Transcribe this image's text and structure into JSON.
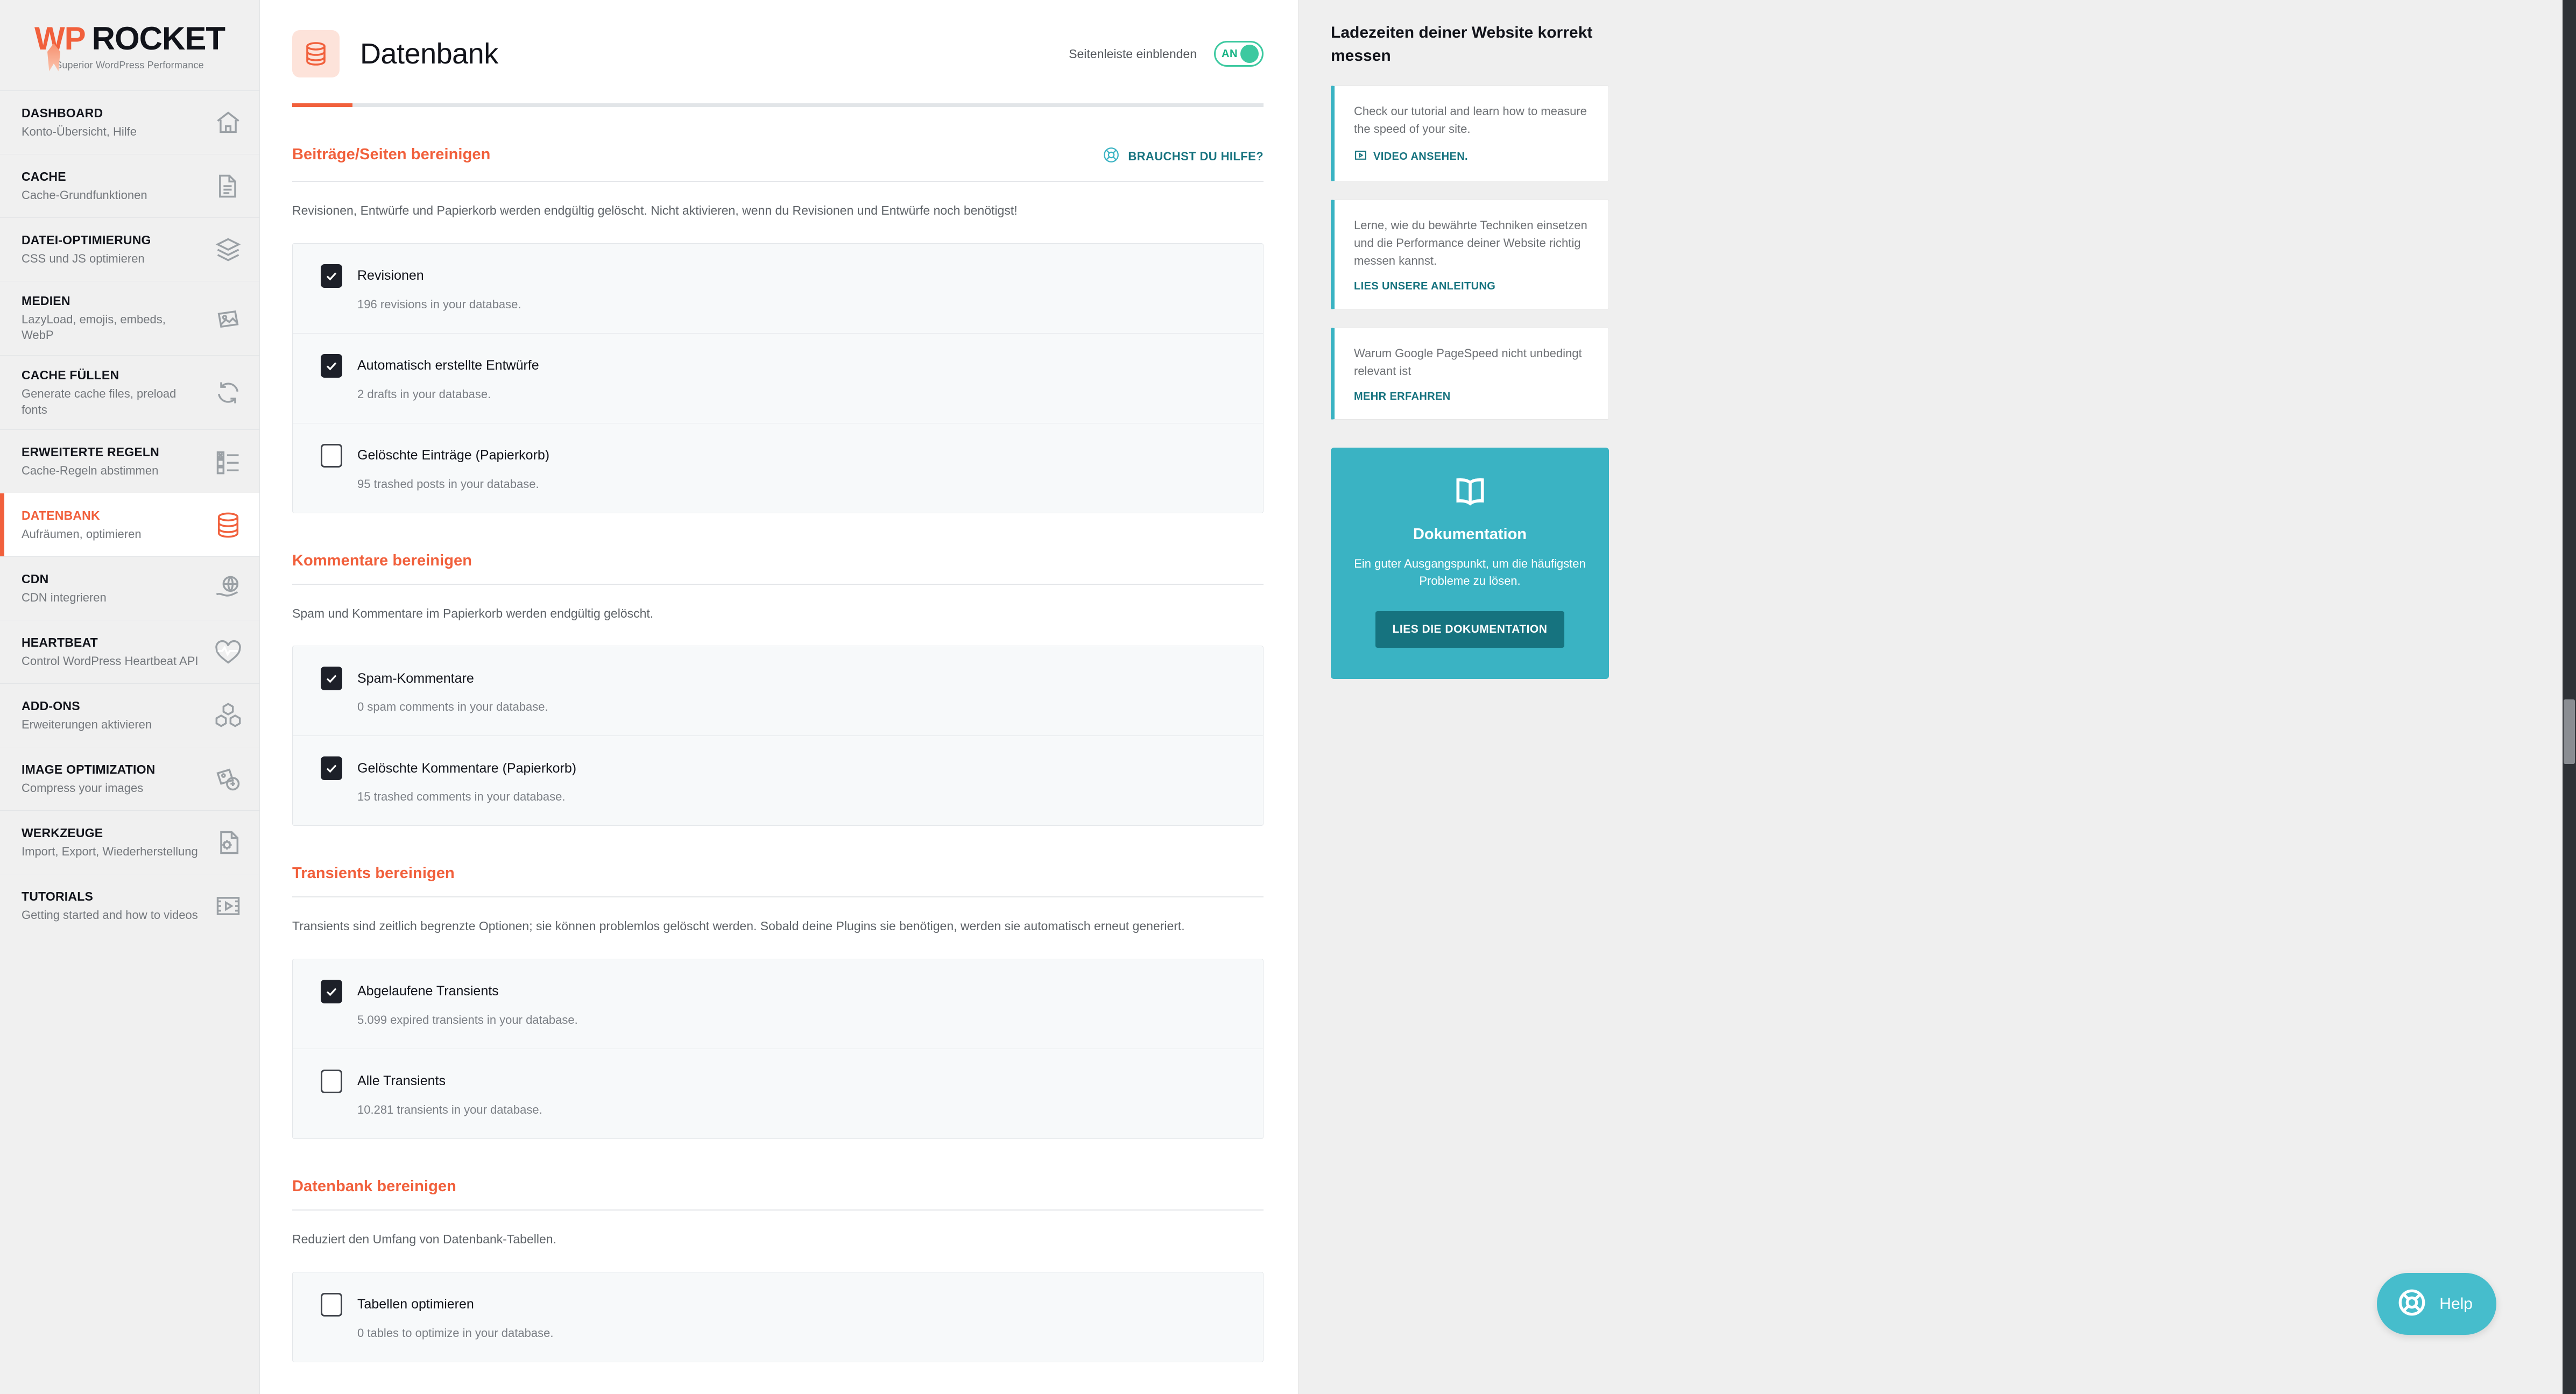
{
  "brand": {
    "name_wp": "WP",
    "name_rocket": "ROCKET",
    "tagline": "Superior WordPress Performance",
    "accent_orange": "#f1603c",
    "accent_teal": "#3ab3c3",
    "accent_teal_dark": "#16737f",
    "accent_green": "#3dc9a0"
  },
  "sidebar": {
    "items": [
      {
        "title": "DASHBOARD",
        "desc": "Konto-Übersicht, Hilfe",
        "icon": "home-icon",
        "active": false
      },
      {
        "title": "CACHE",
        "desc": "Cache-Grundfunktionen",
        "icon": "document-icon",
        "active": false
      },
      {
        "title": "DATEI-OPTIMIERUNG",
        "desc": "CSS und JS optimieren",
        "icon": "layers-icon",
        "active": false
      },
      {
        "title": "MEDIEN",
        "desc": "LazyLoad, emojis, embeds, WebP",
        "icon": "image-icon",
        "active": false
      },
      {
        "title": "CACHE FÜLLEN",
        "desc": "Generate cache files, preload fonts",
        "icon": "refresh-icon",
        "active": false
      },
      {
        "title": "ERWEITERTE REGELN",
        "desc": "Cache-Regeln abstimmen",
        "icon": "checklist-icon",
        "active": false
      },
      {
        "title": "DATENBANK",
        "desc": "Aufräumen, optimieren",
        "icon": "database-icon",
        "active": true
      },
      {
        "title": "CDN",
        "desc": "CDN integrieren",
        "icon": "globe-hand-icon",
        "active": false
      },
      {
        "title": "HEARTBEAT",
        "desc": "Control WordPress Heartbeat API",
        "icon": "heartbeat-icon",
        "active": false
      },
      {
        "title": "ADD-ONS",
        "desc": "Erweiterungen aktivieren",
        "icon": "cubes-icon",
        "active": false
      },
      {
        "title": "IMAGE OPTIMIZATION",
        "desc": "Compress your images",
        "icon": "image-compress-icon",
        "active": false
      },
      {
        "title": "WERKZEUGE",
        "desc": "Import, Export, Wiederherstellung",
        "icon": "file-gear-icon",
        "active": false
      },
      {
        "title": "TUTORIALS",
        "desc": "Getting started and how to videos",
        "icon": "video-icon",
        "active": false
      }
    ]
  },
  "header": {
    "title": "Datenbank",
    "icon": "database-icon",
    "toggle_label": "Seitenleiste einblenden",
    "toggle_state": "AN"
  },
  "sections": [
    {
      "title": "Beiträge/Seiten bereinigen",
      "help_label": "BRAUCHST DU HILFE?",
      "has_help": true,
      "desc": "Revisionen, Entwürfe und Papierkorb werden endgültig gelöscht. Nicht aktivieren, wenn du Revisionen und Entwürfe noch benötigst!",
      "options": [
        {
          "label": "Revisionen",
          "sub": "196 revisions in your database.",
          "checked": true
        },
        {
          "label": "Automatisch erstellte Entwürfe",
          "sub": "2 drafts in your database.",
          "checked": true
        },
        {
          "label": "Gelöschte Einträge (Papierkorb)",
          "sub": "95 trashed posts in your database.",
          "checked": false
        }
      ]
    },
    {
      "title": "Kommentare bereinigen",
      "help_label": "",
      "has_help": false,
      "desc": "Spam und Kommentare im Papierkorb werden endgültig gelöscht.",
      "options": [
        {
          "label": "Spam-Kommentare",
          "sub": "0 spam comments in your database.",
          "checked": true
        },
        {
          "label": "Gelöschte Kommentare (Papierkorb)",
          "sub": "15 trashed comments in your database.",
          "checked": true
        }
      ]
    },
    {
      "title": "Transients bereinigen",
      "help_label": "",
      "has_help": false,
      "desc": "Transients sind zeitlich begrenzte Optionen; sie können problemlos gelöscht werden. Sobald deine Plugins sie benötigen, werden sie automatisch erneut generiert.",
      "options": [
        {
          "label": "Abgelaufene Transients",
          "sub": "5.099 expired transients in your database.",
          "checked": true
        },
        {
          "label": "Alle Transients",
          "sub": "10.281 transients in your database.",
          "checked": false
        }
      ]
    },
    {
      "title": "Datenbank bereinigen",
      "help_label": "",
      "has_help": false,
      "desc": "Reduziert den Umfang von Datenbank-Tabellen.",
      "options": [
        {
          "label": "Tabellen optimieren",
          "sub": "0 tables to optimize in your database.",
          "checked": false
        }
      ]
    }
  ],
  "aside": {
    "title": "Ladezeiten deiner Website korrekt messen",
    "cards": [
      {
        "text": "Check our tutorial and learn how to measure the speed of your site.",
        "link": "VIDEO ANSEHEN.",
        "icon": "video-icon"
      },
      {
        "text": "Lerne, wie du bewährte Techniken einsetzen und die Performance deiner Website richtig messen kannst.",
        "link": "LIES UNSERE ANLEITUNG",
        "icon": ""
      },
      {
        "text": "Warum Google PageSpeed nicht unbedingt relevant ist",
        "link": "MEHR ERFAHREN",
        "icon": ""
      }
    ],
    "doc": {
      "icon": "book-icon",
      "title": "Dokumentation",
      "text": "Ein guter Ausgangspunkt, um die häufigsten Probleme zu lösen.",
      "button": "LIES DIE DOKUMENTATION"
    },
    "help_fab": {
      "label": "Help",
      "icon": "lifebuoy-icon"
    }
  }
}
